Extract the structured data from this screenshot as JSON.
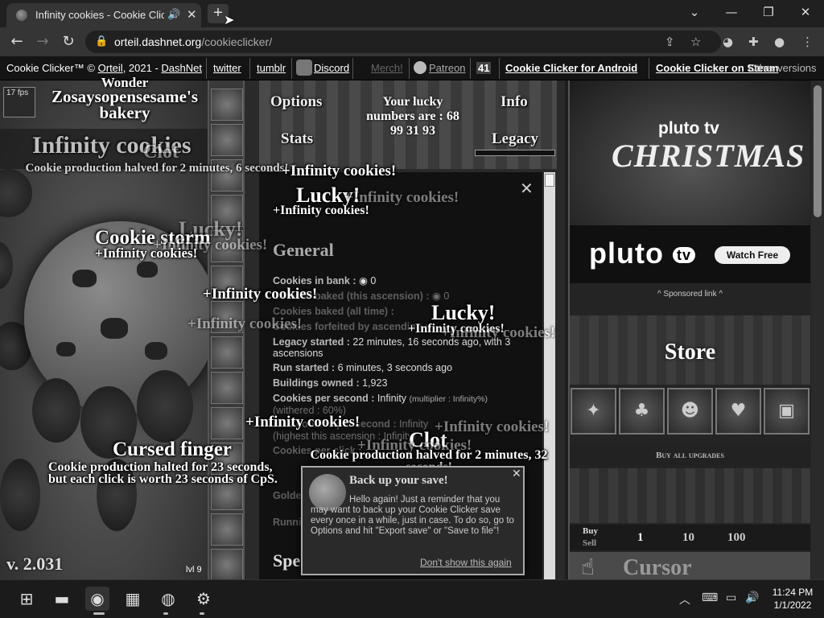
{
  "browser": {
    "tab_title": "Infinity cookies - Cookie Clicker",
    "url_domain": "orteil.dashnet.org",
    "url_path": "/cookieclicker/"
  },
  "topbar": {
    "credit_prefix": "Cookie Clicker™ ©",
    "orteil": "Orteil",
    "credit_year": ", 2021 -",
    "dashnet": "DashNet",
    "twitter": "twitter",
    "tumblr": "tumblr",
    "discord": "Discord",
    "merch": "Merch!",
    "patreon": "Patreon",
    "badge": "41",
    "android": "Cookie Clicker for Android",
    "steam": "Cookie Clicker on Steam",
    "versions": "Other versions"
  },
  "left": {
    "fps": "17 fps",
    "bakery_line1": "Wonder",
    "bakery_line2": "Zosaysopensesame's",
    "bakery_line3": "bakery",
    "version": "v. 2.031",
    "level": "lvl 9"
  },
  "menu": {
    "options": "Options",
    "stats": "Stats",
    "info": "Info",
    "legacy": "Legacy",
    "lucky_line1": "Your lucky",
    "lucky_line2": "numbers are : 68",
    "lucky_line3": "99 31 93"
  },
  "stats": {
    "header_general": "General",
    "header_special": "Spe",
    "bank_label": "Cookies in bank :",
    "bank_value": "0",
    "baked_ascension_label": "Cookies baked (this ascension) :",
    "baked_ascension_value": "0",
    "baked_all_label": "Cookies baked (all time) :",
    "forfeited_label": "Cookies forfeited by ascending :",
    "legacy_label": "Legacy started :",
    "legacy_value": "22 minutes, 16 seconds ago, with 3 ascensions",
    "run_label": "Run started :",
    "run_value": "6 minutes, 3 seconds ago",
    "buildings_label": "Buildings owned :",
    "buildings_value": "1,923",
    "cps_label": "Cookies per second :",
    "cps_value": "Infinity",
    "cps_mult": "(multiplier : Infinity%)",
    "withered": "(withered : 60%)",
    "raw_label": "Raw cookies per second :",
    "raw_value": "Infinity",
    "raw_sub": "(highest this ascension : Infinity)",
    "click_label": "Cookies per click :",
    "golden_label": "Golden cookie clicks :",
    "running_label": "Running version :"
  },
  "floats": {
    "infinity": "+Infinity cookies!",
    "infinity_title": "Infinity cookies",
    "lucky": "Lucky!",
    "cookie_storm": "Cookie storm",
    "clot": "Clot",
    "clot_desc": "Cookie production halved for 2 minutes, 32 seconds!",
    "clot_desc_short": "Cookie production halved for 2 minutes, 6 seconds!",
    "cursed": "Cursed finger",
    "cursed_desc1": "Cookie production halted for 23 seconds,",
    "cursed_desc2": "but each click is worth 23 seconds of CpS."
  },
  "notification": {
    "title": "Back up your save!",
    "body": "Hello again! Just a reminder that you may want to back up your Cookie Clicker save every once in a while, just in case. To do so, go to Options and hit \"Export save\" or \"Save to file\"!",
    "dont_show": "Don't show this again"
  },
  "ads": {
    "pluto_small": "pluto tv",
    "christmas": "CHRISTMAS",
    "pluto_big": "pluto",
    "tv": "tv",
    "watch_free": "Watch Free",
    "sponsored": "^ Sponsored link ^"
  },
  "store": {
    "title": "Store",
    "buy_all": "Buy all upgrades",
    "buy": "Buy",
    "sell": "Sell",
    "amounts": [
      "1",
      "10",
      "100"
    ],
    "cursor": "Cursor"
  },
  "taskbar": {
    "time": "11:24 PM",
    "date": "1/1/2022"
  }
}
